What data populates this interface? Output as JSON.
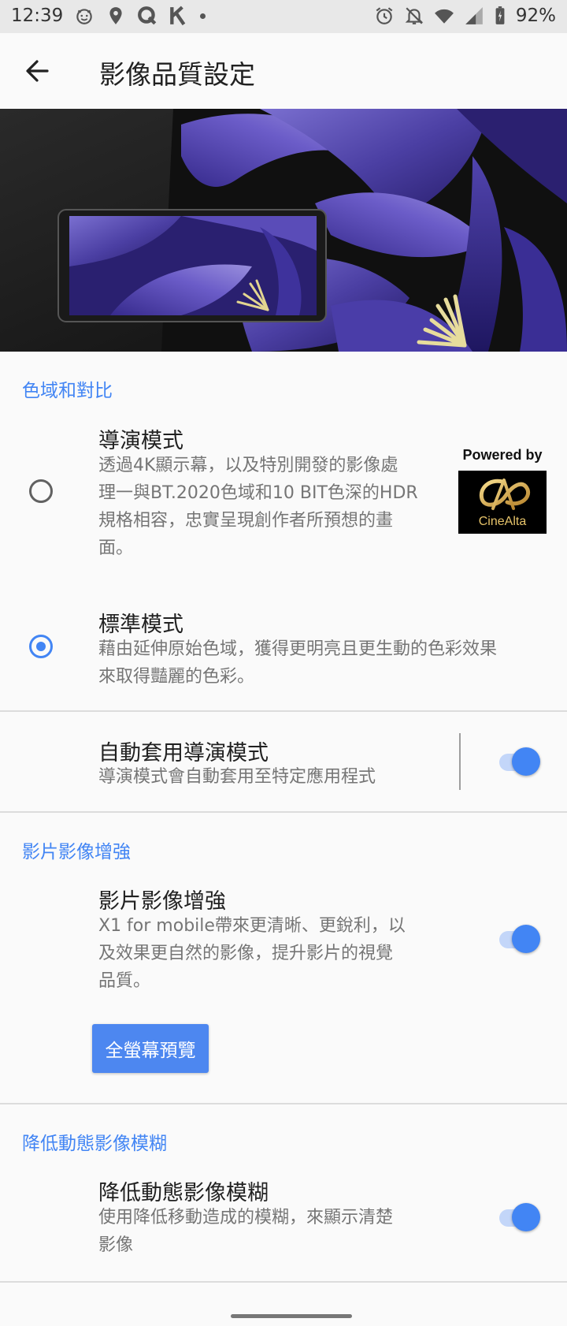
{
  "status_bar": {
    "time": "12:39",
    "battery_percent": "92%",
    "left_icons": [
      "emoji-icon",
      "location-icon",
      "q-app-icon",
      "k-app-icon",
      "dot-icon"
    ],
    "right_icons": [
      "alarm-icon",
      "notifications-off-icon",
      "wifi-icon",
      "signal-icon",
      "battery-icon"
    ]
  },
  "app_bar": {
    "title": "影像品質設定",
    "back_icon": "arrow-back-icon"
  },
  "hero": {
    "description_icon": "iris-flower-banner-image"
  },
  "section_color": {
    "header": "色域和對比",
    "options": [
      {
        "title": "導演模式",
        "description_lines": [
          "透過4K顯示幕，以及特別開發的影像處",
          "理一與BT.2020色域和10 BIT色深的HDR",
          "規格相容，忠實呈現創作者所預想的畫",
          "面。"
        ],
        "checked": false
      },
      {
        "title": "標準模式",
        "description_lines": [
          "藉由延伸原始色域，獲得更明亮且更生動的色彩效果",
          "來取得豔麗的色彩。"
        ],
        "checked": true
      }
    ],
    "badge": {
      "top_text": "Powered by",
      "logo_text": "CineAlta"
    },
    "auto_item": {
      "title": "自動套用導演模式",
      "description": "導演模式會自動套用至特定應用程式",
      "enabled": true
    }
  },
  "section_video": {
    "header": "影片影像增強",
    "item": {
      "title": "影片影像增強",
      "description_lines": [
        "X1 for mobile帶來更清晰、更銳利，以",
        "及效果更自然的影像，提升影片的視覺",
        "品質。"
      ],
      "enabled": true
    },
    "preview_button": "全螢幕預覽"
  },
  "section_motion": {
    "header": "降低動態影像模糊",
    "item": {
      "title": "降低動態影像模糊",
      "description_lines": [
        "使用降低移動造成的模糊，來顯示清楚",
        "影像"
      ],
      "enabled": true
    }
  },
  "colors": {
    "accent": "#4285f4",
    "background": "#fafafa",
    "status_bar": "#e8e8e8",
    "secondary_text": "#757575"
  }
}
